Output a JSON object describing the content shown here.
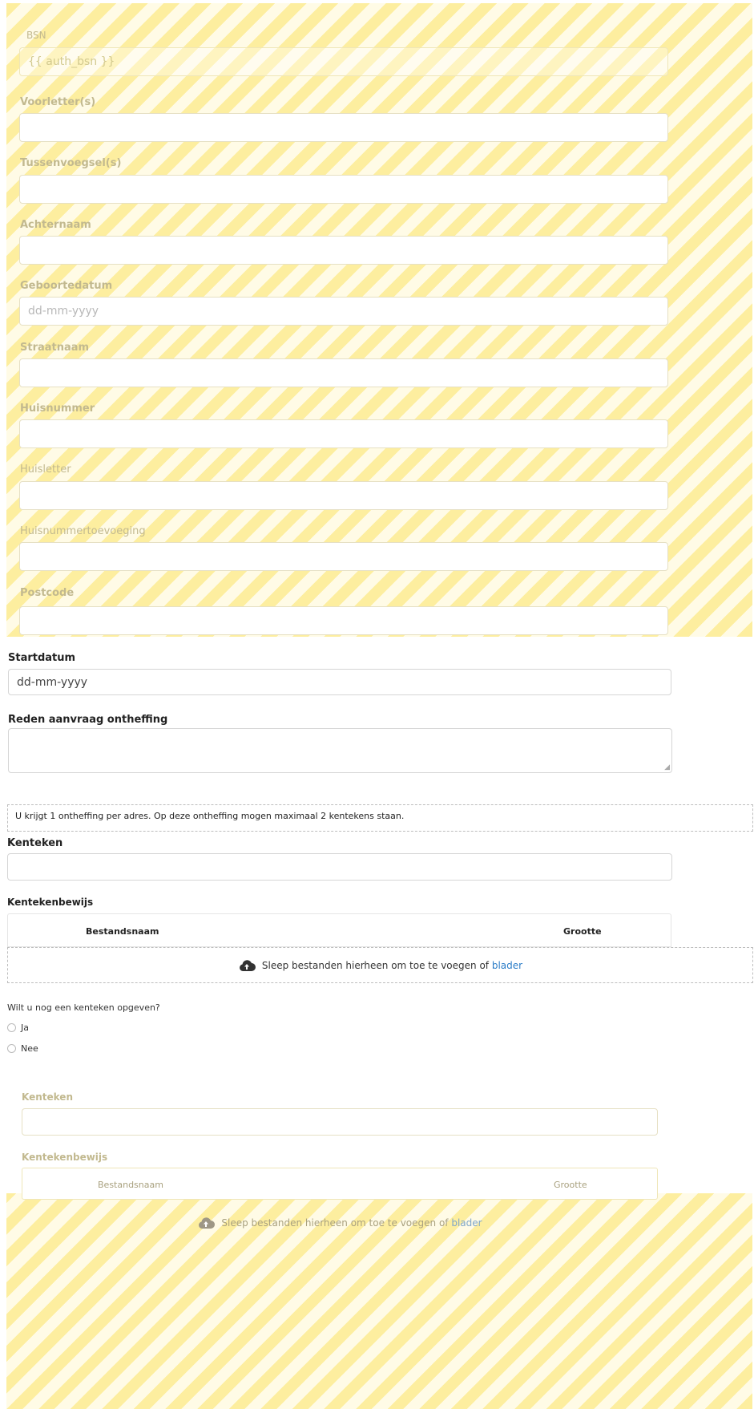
{
  "personal": {
    "bsn": {
      "label": "BSN",
      "value": "{{ auth_bsn }}"
    },
    "voorletters": {
      "label": "Voorletter(s)"
    },
    "tussenvoegsels": {
      "label": "Tussenvoegsel(s)"
    },
    "achternaam": {
      "label": "Achternaam"
    },
    "geboortedatum": {
      "label": "Geboortedatum",
      "placeholder": "dd-mm-yyyy"
    },
    "straatnaam": {
      "label": "Straatnaam"
    },
    "huisnummer": {
      "label": "Huisnummer"
    },
    "huisletter": {
      "label": "Huisletter"
    },
    "huisnummertoevoeging": {
      "label": "Huisnummertoevoeging"
    },
    "postcode": {
      "label": "Postcode"
    }
  },
  "startdatum": {
    "label": "Startdatum",
    "placeholder": "dd-mm-yyyy"
  },
  "reden": {
    "label": "Reden aanvraag ontheffing"
  },
  "notice": {
    "text": "U krijgt 1 ontheffing per adres. Op deze ontheffing mogen maximaal 2 kentekens staan."
  },
  "kenteken1": {
    "label": "Kenteken",
    "file_label": "Kentekenbewijs",
    "col_name": "Bestandsnaam",
    "col_size": "Grootte",
    "drop_text": "Sleep bestanden hierheen om toe te voegen of",
    "browse": "blader"
  },
  "question": {
    "text": "Wilt u nog een kenteken opgeven?",
    "options": [
      "Ja",
      "Nee"
    ]
  },
  "kenteken2": {
    "label": "Kenteken",
    "file_label": "Kentekenbewijs",
    "col_name": "Bestandsnaam",
    "col_size": "Grootte",
    "drop_text": "Sleep bestanden hierheen om toe te voegen of",
    "browse": "blader"
  },
  "colors": {
    "stripe_a": "#fdee9f",
    "stripe_b": "#fffbe6",
    "link": "#2a7cc7"
  },
  "icons": {
    "upload": "cloud-upload-icon"
  }
}
